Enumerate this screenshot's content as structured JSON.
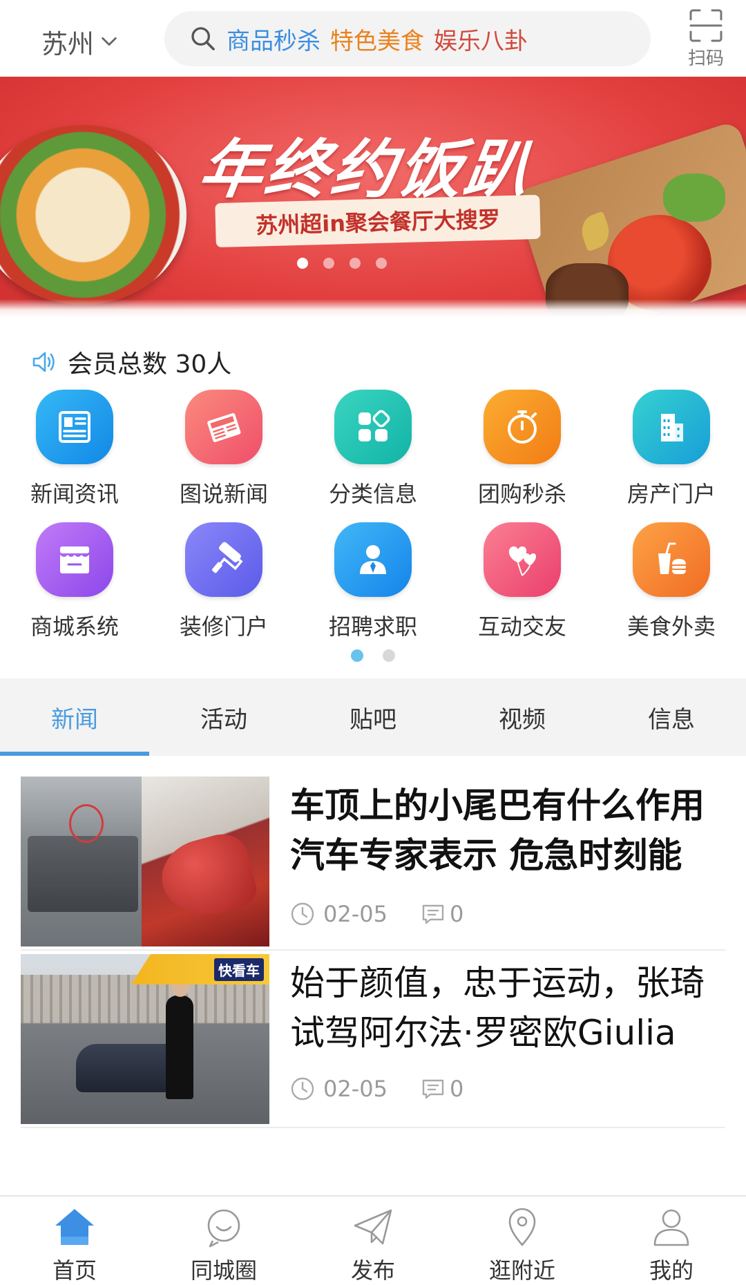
{
  "header": {
    "city": "苏州",
    "search_keywords": [
      {
        "text": "商品秒杀",
        "color": "#3b8ee0"
      },
      {
        "text": "特色美食",
        "color": "#e9821e"
      },
      {
        "text": "娱乐八卦",
        "color": "#d24a3c"
      }
    ],
    "scan_label": "扫码"
  },
  "banner": {
    "title": "年终约饭趴",
    "subtitle": "苏州超in聚会餐厅大搜罗",
    "slide_count": 4,
    "active_slide": 1
  },
  "notice": {
    "icon": "speaker-icon",
    "text": "会员总数 30人"
  },
  "grid": {
    "items": [
      {
        "label": "新闻资讯",
        "icon": "news-icon",
        "color": "#1aa3ee"
      },
      {
        "label": "图说新闻",
        "icon": "newspaper-icon",
        "color": "#f4676a"
      },
      {
        "label": "分类信息",
        "icon": "category-icon",
        "color": "#1cc7b6"
      },
      {
        "label": "团购秒杀",
        "icon": "stopwatch-icon",
        "color": "#f5951e"
      },
      {
        "label": "房产门户",
        "icon": "building-icon",
        "color": "#19b6d9"
      },
      {
        "label": "商城系统",
        "icon": "store-icon",
        "color": "#a55df2"
      },
      {
        "label": "装修门户",
        "icon": "paint-roller-icon",
        "color": "#6f6ff5"
      },
      {
        "label": "招聘求职",
        "icon": "person-tie-icon",
        "color": "#1ea1f3"
      },
      {
        "label": "互动交友",
        "icon": "balloon-hearts-icon",
        "color": "#f2557c"
      },
      {
        "label": "美食外卖",
        "icon": "food-drink-icon",
        "color": "#f58a2a"
      }
    ],
    "page_count": 2,
    "active_page": 1
  },
  "tabs": {
    "items": [
      "新闻",
      "活动",
      "贴吧",
      "视频",
      "信息"
    ],
    "active_index": 0,
    "active_color": "#4a9be0"
  },
  "news": {
    "items": [
      {
        "title": "车顶上的小尾巴有什么作用 汽车专家表示 危急时刻能",
        "date": "02-05",
        "comments": "0"
      },
      {
        "title": "始于颜值，忠于运动，张琦试驾阿尔法·罗密欧Giulia",
        "date": "02-05",
        "comments": "0",
        "thumb_badge": "快看车"
      }
    ]
  },
  "bottom_nav": {
    "items": [
      {
        "label": "首页",
        "icon": "home-icon",
        "active": true
      },
      {
        "label": "同城圈",
        "icon": "smiley-icon",
        "active": false
      },
      {
        "label": "发布",
        "icon": "paper-plane-icon",
        "active": false
      },
      {
        "label": "逛附近",
        "icon": "location-pin-icon",
        "active": false
      },
      {
        "label": "我的",
        "icon": "user-icon",
        "active": false
      }
    ],
    "accent": "#3d8fe3"
  }
}
